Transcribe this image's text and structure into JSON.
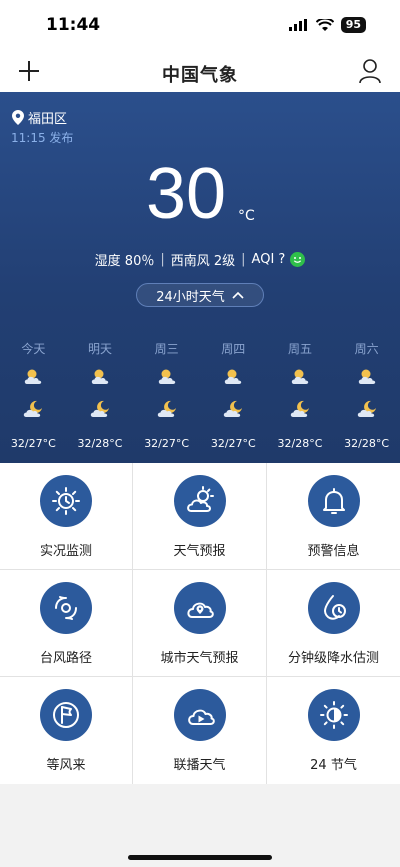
{
  "status_bar": {
    "time": "11:44",
    "battery": "95"
  },
  "header": {
    "logo": "中国气象"
  },
  "weather": {
    "location": "福田区",
    "update_time": "11:15 发布",
    "temperature": "30",
    "unit": "°C",
    "humidity": "湿度 80％",
    "wind": "西南风 2级",
    "aqi": "AQI ?",
    "toggle_label": "24小时天气"
  },
  "forecast": [
    {
      "day": "今天",
      "day_icon": "cloud-sun-icon",
      "night_icon": "cloud-moon-icon",
      "temp": "32/27°C"
    },
    {
      "day": "明天",
      "day_icon": "cloud-sun-icon",
      "night_icon": "cloud-moon-icon",
      "temp": "32/28°C"
    },
    {
      "day": "周三",
      "day_icon": "cloud-sun-icon",
      "night_icon": "cloud-moon-icon",
      "temp": "32/27°C"
    },
    {
      "day": "周四",
      "day_icon": "cloud-sun-icon",
      "night_icon": "cloud-moon-icon",
      "temp": "32/27°C"
    },
    {
      "day": "周五",
      "day_icon": "cloud-sun-icon",
      "night_icon": "cloud-moon-icon",
      "temp": "32/28°C"
    },
    {
      "day": "周六",
      "day_icon": "cloud-sun-icon",
      "night_icon": "cloud-moon-icon",
      "temp": "32/28°C"
    }
  ],
  "services": [
    {
      "label": "实况监测",
      "icon": "clock-sun-icon"
    },
    {
      "label": "天气预报",
      "icon": "cloud-sun-icon"
    },
    {
      "label": "预警信息",
      "icon": "bell-icon"
    },
    {
      "label": "台风路径",
      "icon": "typhoon-icon"
    },
    {
      "label": "城市天气预报",
      "icon": "cloud-pin-icon"
    },
    {
      "label": "分钟级降水估测",
      "icon": "drop-clock-icon"
    },
    {
      "label": "等风来",
      "icon": "wind-flag-icon"
    },
    {
      "label": "联播天气",
      "icon": "cloud-play-icon"
    },
    {
      "label": "24 节气",
      "icon": "solar-term-icon"
    }
  ],
  "colors": {
    "panel": "#223f73",
    "tile_icon_bg": "#2c5a9c",
    "sun": "#f2c14e"
  }
}
